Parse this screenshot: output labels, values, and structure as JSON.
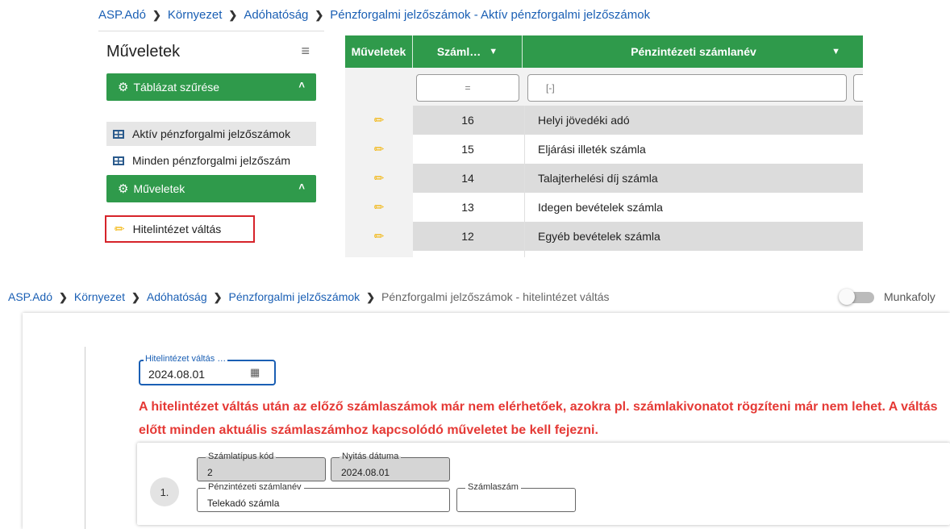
{
  "top": {
    "breadcrumb": [
      {
        "label": "ASP.Adó"
      },
      {
        "label": "Környezet"
      },
      {
        "label": "Adóhatóság"
      },
      {
        "label": "Pénzforgalmi jelzőszámok - Aktív pénzforgalmi jelzőszámok"
      }
    ],
    "sidebar": {
      "title": "Műveletek",
      "menu_icon": "hamburger-icon",
      "sections": [
        {
          "label": "Táblázat szűrése",
          "icon": "gear-icon"
        },
        {
          "label": "Műveletek",
          "icon": "gear-icon"
        }
      ],
      "filter_items": [
        {
          "label": "Aktív pénzforgalmi jelzőszámok",
          "active": true
        },
        {
          "label": "Minden pénzforgalmi jelzőszám",
          "active": false
        }
      ],
      "action_item": {
        "label": "Hitelintézet váltás",
        "highlight_color": "#d6232a"
      }
    },
    "table": {
      "headers": {
        "actions": "Műveletek",
        "number": "Száml…",
        "name": "Pénzintézeti számlanév"
      },
      "filters": {
        "number": "=",
        "name": "[-]"
      },
      "rows": [
        {
          "number": "16",
          "name": "Helyi jövedéki adó"
        },
        {
          "number": "15",
          "name": "Eljárási illeték számla"
        },
        {
          "number": "14",
          "name": "Talajterhelési díj számla"
        },
        {
          "number": "13",
          "name": "Idegen bevételek számla"
        },
        {
          "number": "12",
          "name": "Egyéb bevételek számla"
        }
      ],
      "header_color": "#2f9a4b"
    }
  },
  "bottom": {
    "breadcrumb": [
      {
        "label": "ASP.Adó"
      },
      {
        "label": "Környezet"
      },
      {
        "label": "Adóhatóság"
      },
      {
        "label": "Pénzforgalmi jelzőszámok"
      },
      {
        "label": "Pénzforgalmi jelzőszámok - hitelintézet váltás"
      }
    ],
    "workflow_label": "Munkafoly",
    "date_field": {
      "label": "Hitelintézet váltás …",
      "value": "2024.08.01"
    },
    "warning": "A hitelintézet váltás után az előző számlaszámok már nem elérhetőek, azokra pl. számlakivonatot rögzíteni már nem lehet. A váltás előtt minden aktuális számlaszámhoz kapcsolódó műveletet be kell fejezni.",
    "warning_color": "#e53935",
    "row": {
      "index": "1.",
      "type_code": {
        "label": "Számlatípus kód",
        "value": "2"
      },
      "open_date": {
        "label": "Nyitás dátuma",
        "value": "2024.08.01"
      },
      "account_name": {
        "label": "Pénzintézeti számlanév",
        "value": "Telekadó számla"
      },
      "account_number": {
        "label": "Számlaszám",
        "value": ""
      }
    }
  }
}
